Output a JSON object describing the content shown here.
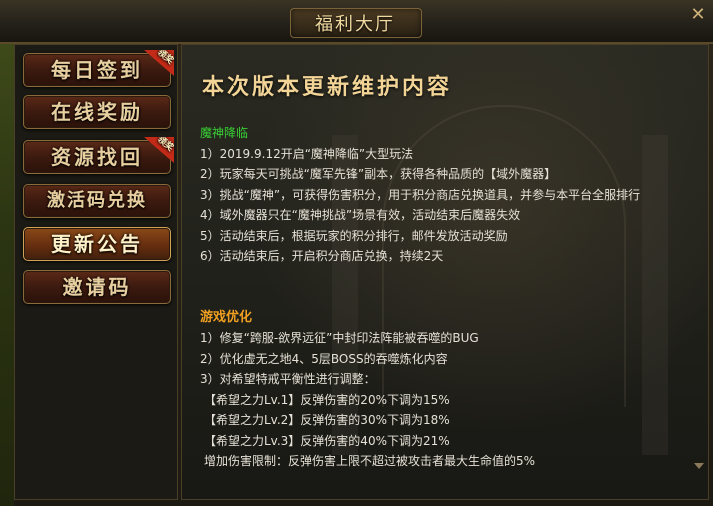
{
  "window": {
    "title": "福利大厅",
    "close_icon": "close-icon"
  },
  "sidebar": {
    "items": [
      {
        "label": "每日签到",
        "badge": "领奖",
        "active": false
      },
      {
        "label": "在线奖励",
        "badge": "",
        "active": false
      },
      {
        "label": "资源找回",
        "badge": "领奖",
        "active": false
      },
      {
        "label": "激活码兑换",
        "badge": "",
        "active": false
      },
      {
        "label": "更新公告",
        "badge": "",
        "active": true
      },
      {
        "label": "邀请码",
        "badge": "",
        "active": false
      }
    ]
  },
  "main": {
    "heading": "本次版本更新维护内容",
    "section1": {
      "title": "魔神降临",
      "lines": [
        "1）2019.9.12开启“魔神降临”大型玩法",
        "2）玩家每天可挑战“魔军先锋”副本，获得各种品质的【域外魔器】",
        "3）挑战“魔神”，可获得伤害积分，用于积分商店兑换道具，并参与本平台全服排行",
        "4）域外魔器只在“魔神挑战”场景有效，活动结束后魔器失效",
        "5）活动结束后，根据玩家的积分排行，邮件发放活动奖励",
        "6）活动结束后，开启积分商店兑换，持续2天"
      ]
    },
    "section2": {
      "title": "游戏优化",
      "lines": [
        "1）修复“跨服-欲界远征”中封印法阵能被吞噬的BUG",
        "2）优化虚无之地4、5层BOSS的吞噬炼化内容",
        "3）对希望特戒平衡性进行调整：",
        "【希望之力Lv.1】反弹伤害的20%下调为15%",
        "【希望之力Lv.2】反弹伤害的30%下调为18%",
        "【希望之力Lv.3】反弹伤害的40%下调为21%",
        "增加伤害限制：反弹伤害上限不超过被攻击者最大生命值的5%"
      ]
    }
  },
  "colors": {
    "accent_green": "#39d135",
    "accent_orange": "#f0a020",
    "badge_red": "#c32a18"
  }
}
